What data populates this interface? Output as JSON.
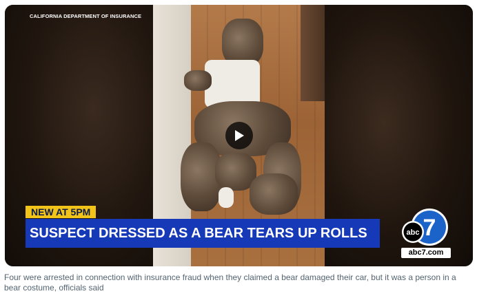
{
  "video": {
    "credit": "CALIFORNIA DEPARTMENT OF INSURANCE",
    "tag": "NEW AT 5PM",
    "headline": "SUSPECT DRESSED AS A BEAR TEARS UP ROLLS",
    "logo_text": "abc",
    "logo_number": "7",
    "logo_site": "abc7.com",
    "play_icon": "play-icon"
  },
  "caption": "Four were arrested in connection with insurance fraud when they claimed a bear damaged their car, but it was a person in a bear costume, officials said",
  "colors": {
    "tag_bg": "#f2c318",
    "headline_bg": "#1639b8",
    "caption_text": "#536471"
  }
}
